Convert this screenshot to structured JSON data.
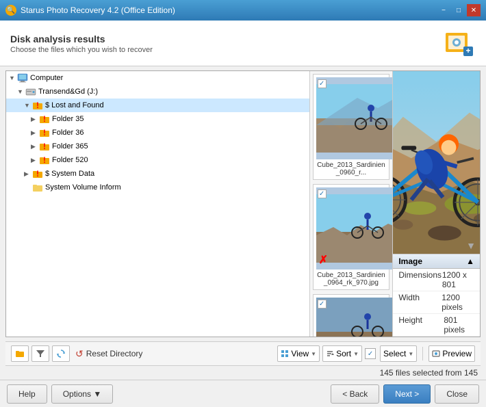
{
  "titleBar": {
    "title": "Starus Photo Recovery 4.2 (Office Edition)",
    "minBtn": "−",
    "maxBtn": "□",
    "closeBtn": "✕"
  },
  "header": {
    "title": "Disk analysis results",
    "subtitle": "Choose the files which you wish to recover"
  },
  "tree": {
    "items": [
      {
        "id": "computer",
        "label": "Computer",
        "level": 0,
        "type": "computer",
        "expanded": true,
        "arrow": "▼"
      },
      {
        "id": "drive",
        "label": "Transend&Gd (J:)",
        "level": 1,
        "type": "drive",
        "expanded": true,
        "arrow": "▼"
      },
      {
        "id": "lost",
        "label": "$ Lost and Found",
        "level": 2,
        "type": "folder-damaged",
        "expanded": true,
        "arrow": "▼"
      },
      {
        "id": "f35",
        "label": "Folder 35",
        "level": 3,
        "type": "folder-damaged",
        "expanded": false,
        "arrow": "▶"
      },
      {
        "id": "f36",
        "label": "Folder 36",
        "level": 3,
        "type": "folder-damaged",
        "expanded": false,
        "arrow": "▶"
      },
      {
        "id": "f365",
        "label": "Folder 365",
        "level": 3,
        "type": "folder-damaged",
        "expanded": false,
        "arrow": "▶"
      },
      {
        "id": "f520",
        "label": "Folder 520",
        "level": 3,
        "type": "folder-damaged",
        "expanded": false,
        "arrow": "▶"
      },
      {
        "id": "sysdata",
        "label": "$ System Data",
        "level": 2,
        "type": "folder-damaged",
        "expanded": false,
        "arrow": "▶"
      },
      {
        "id": "sysvolume",
        "label": "System Volume Inform",
        "level": 2,
        "type": "folder",
        "expanded": false,
        "arrow": ""
      }
    ]
  },
  "thumbnails": [
    {
      "filename": "Cube_2013_Sardinien_0960_r...",
      "checked": true,
      "damaged": false
    },
    {
      "filename": "Cube_2013_Sardinien_0964_rk_970.jpg",
      "checked": true,
      "damaged": true
    },
    {
      "filename": "",
      "checked": true,
      "damaged": true
    }
  ],
  "preview": {
    "imageDesc": "Mountain biker on rocky terrain - preview"
  },
  "imageInfo": {
    "sectionLabel": "Image",
    "rows": [
      {
        "label": "Dimensions",
        "value": "1200 x 801"
      },
      {
        "label": "Width",
        "value": "1200 pixels"
      },
      {
        "label": "Height",
        "value": "801 pixels"
      }
    ],
    "collapseIcon": "▲"
  },
  "toolbar": {
    "viewLabel": "View",
    "sortLabel": "Sort",
    "selectLabel": "Select",
    "previewLabel": "Preview",
    "resetLabel": "Reset Directory",
    "statusText": "145 files selected from 145"
  },
  "bottomBar": {
    "helpLabel": "Help",
    "optionsLabel": "Options ▼",
    "backLabel": "< Back",
    "nextLabel": "Next >",
    "closeLabel": "Close"
  }
}
